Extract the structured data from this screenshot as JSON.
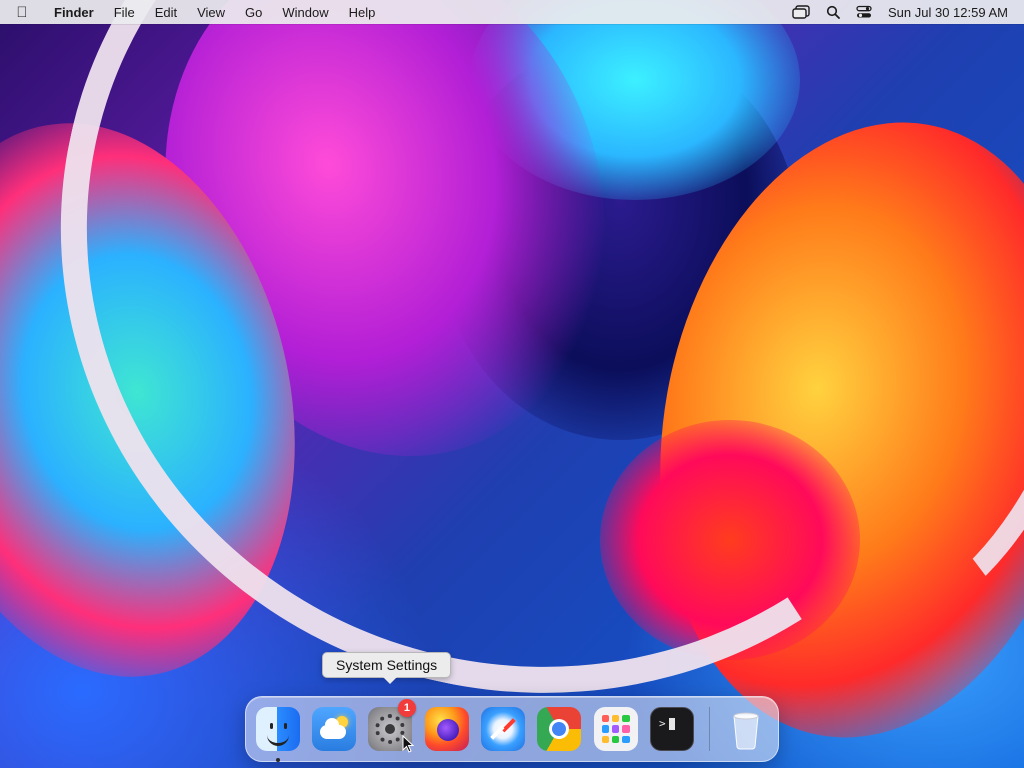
{
  "menubar": {
    "app_name": "Finder",
    "menus": [
      "File",
      "Edit",
      "View",
      "Go",
      "Window",
      "Help"
    ],
    "clock": "Sun Jul 30  12:59 AM",
    "status_icons": [
      "stage-manager-icon",
      "search-icon",
      "control-center-icon"
    ]
  },
  "tooltip": {
    "text": "System Settings"
  },
  "dock": {
    "apps": [
      {
        "name": "Finder",
        "icon": "finder-icon",
        "running": true
      },
      {
        "name": "Weather",
        "icon": "weather-icon",
        "running": false
      },
      {
        "name": "System Settings",
        "icon": "settings-icon",
        "badge": "1",
        "running": false
      },
      {
        "name": "Firefox",
        "icon": "firefox-icon",
        "running": false
      },
      {
        "name": "Safari",
        "icon": "safari-icon",
        "running": false
      },
      {
        "name": "Chrome",
        "icon": "chrome-icon",
        "running": false
      },
      {
        "name": "Launchpad",
        "icon": "launchpad-icon",
        "running": false
      },
      {
        "name": "Terminal",
        "icon": "terminal-icon",
        "running": false
      }
    ],
    "trash": {
      "name": "Trash",
      "icon": "trash-icon"
    }
  },
  "colors": {
    "menubar_bg": "#ecececee",
    "badge": "#f23c3c",
    "tooltip_bg": "#ececec"
  }
}
